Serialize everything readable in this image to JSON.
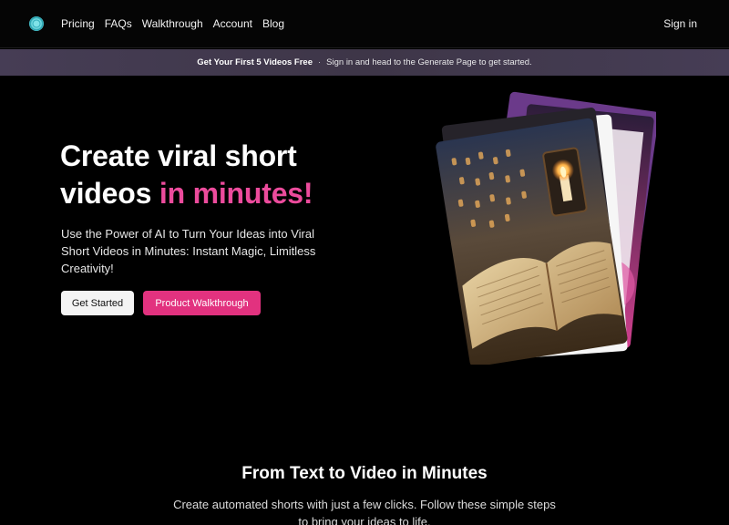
{
  "nav": {
    "links": [
      "Pricing",
      "FAQs",
      "Walkthrough",
      "Account",
      "Blog"
    ],
    "sign_in": "Sign in"
  },
  "banner": {
    "bold": "Get Your First 5 Videos Free",
    "separator": "·",
    "text": "Sign in and head to the Generate Page to get started."
  },
  "hero": {
    "title_line1": "Create viral short",
    "title_line2_start": "videos ",
    "title_line2_accent": "in minutes!",
    "subtitle": "Use the Power of AI to Turn Your Ideas into Viral Short Videos in Minutes: Instant Magic, Limitless Creativity!",
    "primary_button": "Get Started",
    "secondary_button": "Product Walkthrough"
  },
  "section": {
    "title": "From Text to Video in Minutes",
    "subtitle": "Create automated shorts with just a few clicks. Follow these simple steps to bring your ideas to life."
  },
  "colors": {
    "accent": "#ec4b9c",
    "button_pink": "#e2327f",
    "background": "#000000",
    "banner": "#433a50"
  }
}
